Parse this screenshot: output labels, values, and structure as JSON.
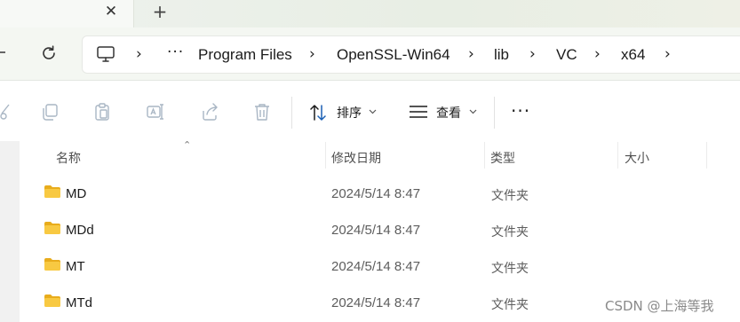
{
  "tabbar": {
    "close_glyph": "✕",
    "new_tab_glyph": "+"
  },
  "address": {
    "items": [
      "Program Files",
      "OpenSSL-Win64",
      "lib",
      "VC",
      "x64"
    ],
    "separator": "›",
    "overflow": "···"
  },
  "toolbar": {
    "sort_label": "排序",
    "view_label": "查看",
    "more": "···"
  },
  "columns": {
    "name": "名称",
    "modified": "修改日期",
    "type": "类型",
    "size": "大小"
  },
  "files": [
    {
      "name": "MD",
      "modified": "2024/5/14 8:47",
      "type": "文件夹"
    },
    {
      "name": "MDd",
      "modified": "2024/5/14 8:47",
      "type": "文件夹"
    },
    {
      "name": "MT",
      "modified": "2024/5/14 8:47",
      "type": "文件夹"
    },
    {
      "name": "MTd",
      "modified": "2024/5/14 8:47",
      "type": "文件夹"
    }
  ],
  "watermark": "CSDN @上海等我",
  "colors": {
    "folder": "#f8c942",
    "folder_dark": "#e8ac1c",
    "accent": "#1a5fb4"
  },
  "icons": [
    "close-icon",
    "plus-icon",
    "refresh-icon",
    "computer-icon",
    "cut-icon",
    "copy-icon",
    "paste-icon",
    "rename-icon",
    "share-icon",
    "delete-icon",
    "sort-icon",
    "view-icon",
    "more-icon",
    "folder-icon"
  ]
}
